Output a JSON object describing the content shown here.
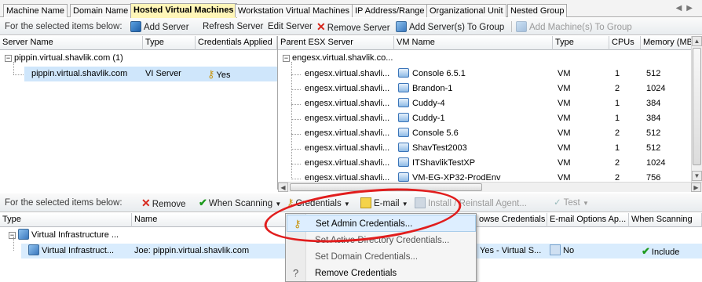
{
  "tabs": [
    {
      "label": "Machine Name"
    },
    {
      "label": "Domain Name"
    },
    {
      "label": "Hosted Virtual Machines"
    },
    {
      "label": "Workstation Virtual Machines"
    },
    {
      "label": "IP Address/Range"
    },
    {
      "label": "Organizational Unit"
    },
    {
      "label": "Nested Group"
    }
  ],
  "top_toolbar": {
    "prefix": "For the selected items below:",
    "add_server": "Add Server",
    "refresh_server": "Refresh Server",
    "edit_server": "Edit Server",
    "remove_server": "Remove Server",
    "add_to_group": "Add Server(s) To Group",
    "add_machines_to_group": "Add Machine(s) To Group"
  },
  "left_grid": {
    "headers": [
      "Server Name",
      "Type",
      "Credentials Applied"
    ],
    "group_label": "pippin.virtual.shavlik.com (1)",
    "row": {
      "server": "pippin.virtual.shavlik.com",
      "type": "VI Server",
      "credentials": "Yes"
    }
  },
  "right_grid": {
    "headers": [
      "Parent ESX Server",
      "VM Name",
      "Type",
      "CPUs",
      "Memory (MB)"
    ],
    "group_label": "engesx.virtual.shavlik.co...",
    "rows": [
      {
        "parent": "engesx.virtual.shavli...",
        "vm": "Console 6.5.1",
        "type": "VM",
        "cpus": "1",
        "mem": "512"
      },
      {
        "parent": "engesx.virtual.shavli...",
        "vm": "Brandon-1",
        "type": "VM",
        "cpus": "2",
        "mem": "1024"
      },
      {
        "parent": "engesx.virtual.shavli...",
        "vm": "Cuddy-4",
        "type": "VM",
        "cpus": "1",
        "mem": "384"
      },
      {
        "parent": "engesx.virtual.shavli...",
        "vm": "Cuddy-1",
        "type": "VM",
        "cpus": "1",
        "mem": "384"
      },
      {
        "parent": "engesx.virtual.shavli...",
        "vm": "Console 5.6",
        "type": "VM",
        "cpus": "2",
        "mem": "512"
      },
      {
        "parent": "engesx.virtual.shavli...",
        "vm": "ShavTest2003",
        "type": "VM",
        "cpus": "1",
        "mem": "512"
      },
      {
        "parent": "engesx.virtual.shavli...",
        "vm": "ITShavlikTestXP",
        "type": "VM",
        "cpus": "2",
        "mem": "1024"
      },
      {
        "parent": "engesx.virtual.shavli...",
        "vm": "VM-EG-XP32-ProdEnv",
        "type": "VM",
        "cpus": "2",
        "mem": "756"
      }
    ]
  },
  "bottom_toolbar": {
    "prefix": "For the selected items below:",
    "remove": "Remove",
    "when_scanning": "When Scanning",
    "credentials": "Credentials",
    "email": "E-mail",
    "install": "Install / Reinstall Agent...",
    "test": "Test"
  },
  "bottom_grid": {
    "headers": [
      "Type",
      "Name",
      "owse Credentials",
      "E-mail Options Ap...",
      "When Scanning"
    ],
    "group_label": "Virtual Infrastructure ...",
    "row": {
      "type": "Virtual Infrastruct...",
      "name": "Joe: pippin.virtual.shavlik.com",
      "browse_creds": "Yes - Virtual S...",
      "email": "No",
      "scanning": "Include"
    }
  },
  "credentials_menu": [
    {
      "label": "Set Admin Credentials..."
    },
    {
      "label": "Set Active Directory Credentials..."
    },
    {
      "label": "Set Domain Credentials..."
    },
    {
      "label": "Remove Credentials"
    }
  ],
  "colors": {
    "active_tab": "#fff6b8",
    "selection": "#cfe6fb",
    "annotation": "#e11d1d"
  }
}
